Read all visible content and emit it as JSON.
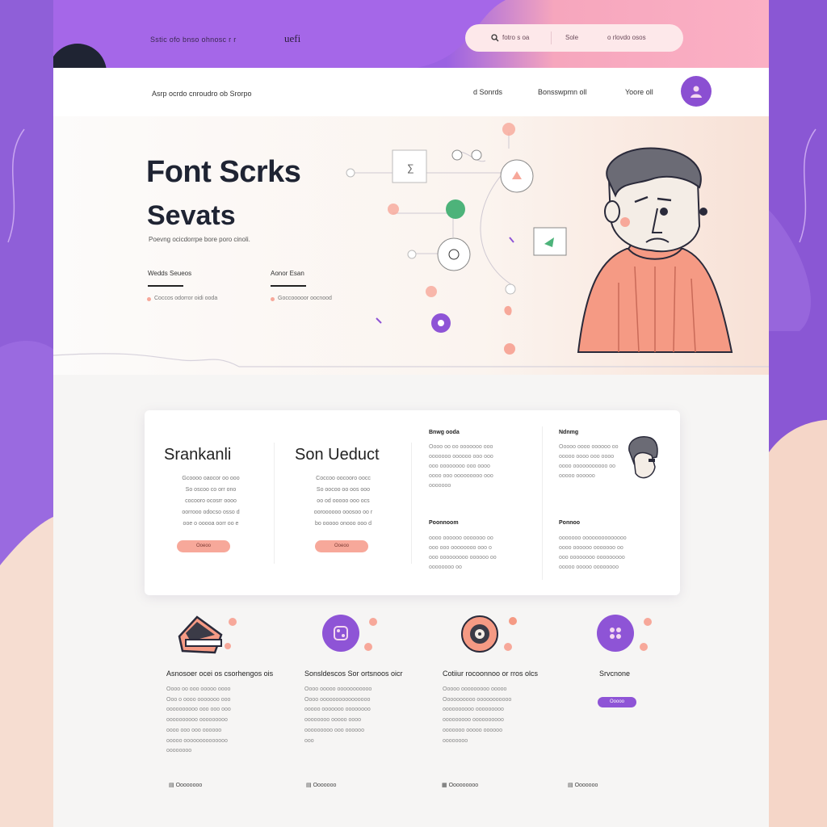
{
  "colors": {
    "purple": "#8b4fd2",
    "pink": "#fbb0c4",
    "peach": "#f7a89a",
    "dark": "#1f2433"
  },
  "topbar": {
    "left_text": "Sstic ofo bnso ohnosc  r r",
    "logo": "uefi",
    "search": {
      "icon": "search-icon",
      "seg1": "fotro s oa",
      "seg2": "Sole",
      "seg3": "o rlovdo osos"
    }
  },
  "nav": {
    "breadcrumb": "Asrp ocrdo cnroudro ob Srorpo",
    "links": [
      "d Sonrds",
      "Bonsswpmn oll",
      "Yoore oll"
    ],
    "avatar_icon": "user-icon"
  },
  "hero": {
    "title_line1": "Font Scrks",
    "title_line2": "Sevats",
    "subtitle": "Poevng ocicdorrpe bore poro cinoli.",
    "stats": [
      {
        "title": "Wedds Seueos",
        "line": "Coccos odorror oidi ooda"
      },
      {
        "title": "Aonor Esan",
        "line": "Goccooooor oocnood"
      }
    ]
  },
  "card": {
    "col1": {
      "title": "Srankanli",
      "text": [
        "Gcoooo oaocor oo ooo",
        "So oscoo co orr ono",
        "cocooro ocosrr oooo",
        "oorrooo odocso osso d",
        "ooe o ooooa oorr oo e"
      ],
      "button": "Ooeoo"
    },
    "col2": {
      "title": "Son Ueduct",
      "text": [
        "Coccoo oocooro oocc",
        "So oocoo oo oos ooo",
        "oo od ooooo ooo ocs",
        "ooroooooo ooosoo oo r",
        "bo ooooo onooo ooo d"
      ],
      "button": "Ooeoo"
    },
    "col3": [
      {
        "title": "Bnwg ooda",
        "text": [
          "Oooo oo oo ooooooo ooo",
          "ooooooo oooooo ooo ooo",
          "ooo oooooooo ooo oooo",
          "oooo ooo ooooooooo ooo",
          "ooooooo"
        ]
      },
      {
        "title": "Poonnoom",
        "text": [
          "oooo oooooo ooooooo oo",
          "ooo ooo oooooooo ooo o",
          "ooo ooooooooo oooooo oo",
          "oooooooo oo"
        ]
      }
    ],
    "col4": [
      {
        "title": "Ndnmg",
        "text": [
          "Ooooo oooo oooooo oo",
          "ooooo oooo ooo oooo",
          "oooo ooooooooooo oo",
          "ooooo oooooo"
        ]
      },
      {
        "title": "Ponnoo",
        "text": [
          "ooooooo oooooooooooooo",
          "oooo oooooo ooooooo oo",
          "ooo oooooooo ooooooooo",
          "ooooo ooooo oooooooo"
        ]
      }
    ]
  },
  "features": [
    {
      "title": "Asnosoer ocei os csorhengos ois",
      "text": [
        "Oooo oo ooo ooooo oooo",
        "Ooo o oooo ooooooo ooo",
        "oooooooooo ooo ooo ooo",
        "oooooooooo ooooooooo",
        "oooo ooo ooo oooooo",
        "ooooo oooooooooooooo",
        "oooooooo"
      ],
      "foot": "Oooooooo",
      "icon": "laptop-icon"
    },
    {
      "title": "Sonsldescos Sor ortsnoos oicr",
      "text": [
        "Oooo ooooo ooooooooooo",
        "Oooo oooooooooooooooo",
        "ooooo ooooooo oooooooo",
        "oooooooo ooooo oooo",
        "ooooooooo ooo oooooo",
        "ooo"
      ],
      "foot": "Ooooooo",
      "icon": "dice-icon"
    },
    {
      "title": "Cotiiur rocoonnoo or rros olcs",
      "text": [
        "Ooooo ooooooooo ooooo",
        "Oooooooooo ooooooooooo",
        "oooooooooo ooooooooo",
        "ooooooooo oooooooooo",
        "ooooooo ooooo oooooo",
        "oooooooo"
      ],
      "foot": "Ooooooooo",
      "icon": "camera-icon"
    },
    {
      "title": "Srvcnone",
      "text": [],
      "foot": "Ooooooo",
      "button": "Ooooo",
      "icon": "grid-icon"
    }
  ]
}
